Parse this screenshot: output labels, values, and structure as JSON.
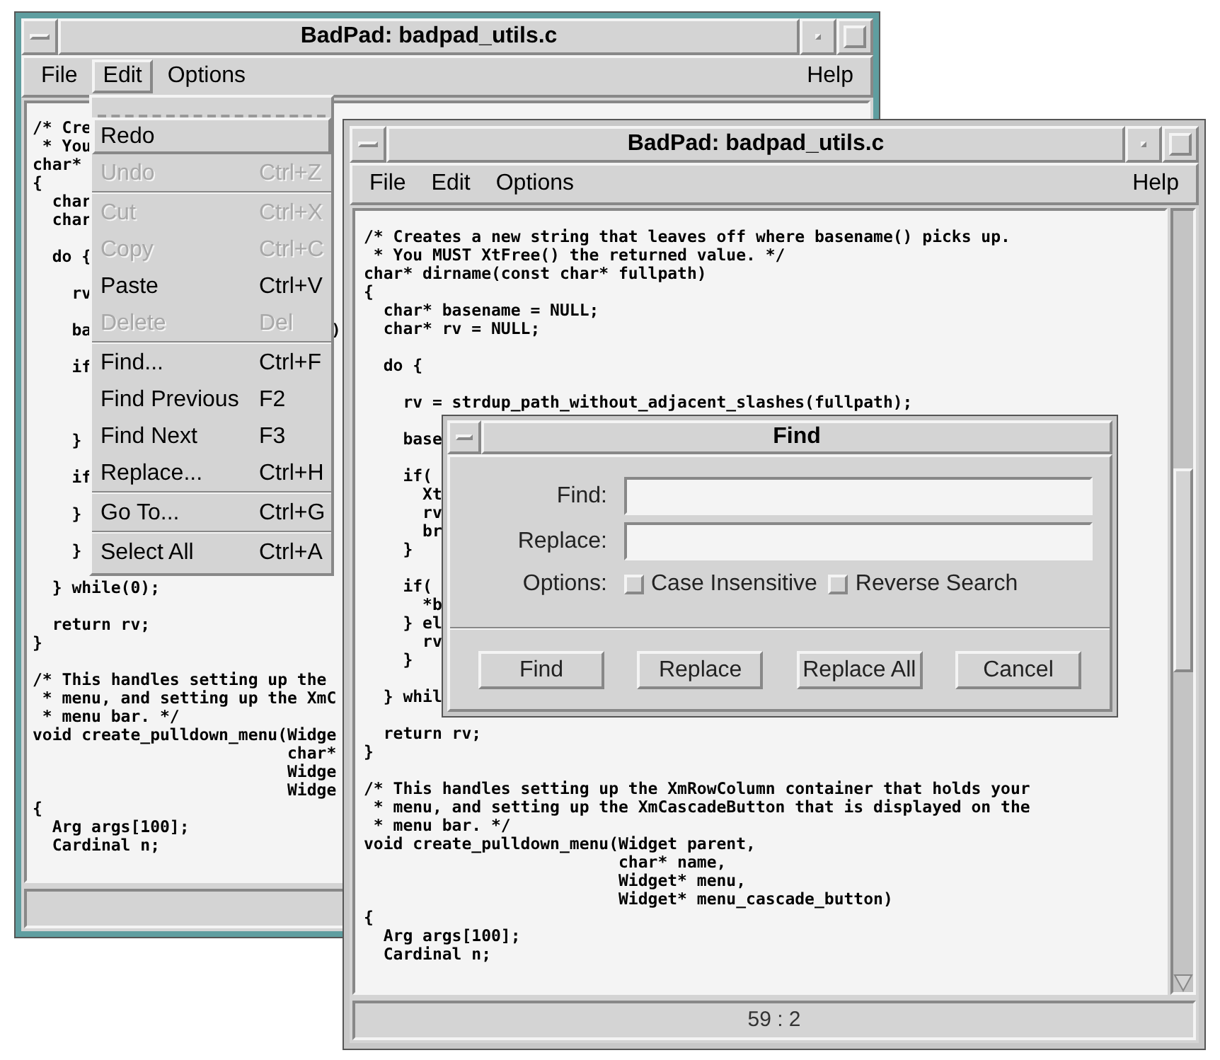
{
  "back_window": {
    "title": "BadPad: badpad_utils.c",
    "active": true,
    "menus": [
      {
        "label": "File",
        "selected": false
      },
      {
        "label": "Edit",
        "selected": true
      },
      {
        "label": "Options",
        "selected": false
      },
      {
        "label": "Help",
        "selected": false
      }
    ],
    "lines": [
      {
        "kind": "code",
        "text": "/* Cre"
      },
      {
        "kind": "code",
        "text": " * You"
      },
      {
        "kind": "code",
        "text": "char*"
      },
      {
        "kind": "code",
        "text": "{"
      },
      {
        "kind": "code",
        "text": "  char"
      },
      {
        "kind": "code",
        "text": "  char"
      },
      {
        "kind": "blank"
      },
      {
        "kind": "code",
        "text": "  do {"
      },
      {
        "kind": "blank"
      },
      {
        "kind": "code",
        "text": "    rv"
      },
      {
        "kind": "blank"
      },
      {
        "kind": "code",
        "text": "    ba",
        "right": ")"
      },
      {
        "kind": "blank"
      },
      {
        "kind": "code",
        "text": "    if"
      },
      {
        "kind": "blank"
      },
      {
        "kind": "blank"
      },
      {
        "kind": "blank"
      },
      {
        "kind": "code",
        "text": "    }"
      },
      {
        "kind": "blank"
      },
      {
        "kind": "code",
        "text": "    if"
      },
      {
        "kind": "blank"
      },
      {
        "kind": "code",
        "text": "    }"
      },
      {
        "kind": "blank"
      },
      {
        "kind": "code",
        "text": "    }"
      },
      {
        "kind": "blank"
      },
      {
        "kind": "code",
        "text": "  } while(0);"
      },
      {
        "kind": "blank"
      },
      {
        "kind": "code",
        "text": "  return rv;"
      },
      {
        "kind": "code",
        "text": "}"
      },
      {
        "kind": "blank"
      },
      {
        "kind": "code",
        "text": "/* This handles setting up the"
      },
      {
        "kind": "code",
        "text": " * menu, and setting up the XmC"
      },
      {
        "kind": "code",
        "text": " * menu bar. */"
      },
      {
        "kind": "code",
        "text": "void create_pulldown_menu(Widge"
      },
      {
        "kind": "code",
        "text": "                          char*"
      },
      {
        "kind": "code",
        "text": "                          Widge"
      },
      {
        "kind": "code",
        "text": "                          Widge"
      },
      {
        "kind": "code",
        "text": "{"
      },
      {
        "kind": "code",
        "text": "  Arg args[100];"
      },
      {
        "kind": "code",
        "text": "  Cardinal n;"
      }
    ]
  },
  "edit_menu": [
    {
      "kind": "tearoff"
    },
    {
      "kind": "item",
      "label": "Redo",
      "selected": true,
      "disabled": false
    },
    {
      "kind": "item",
      "label": "Undo",
      "shortcut": "Ctrl+Z",
      "selected": false,
      "disabled": true
    },
    {
      "kind": "separator"
    },
    {
      "kind": "item",
      "label": "Cut",
      "shortcut": "Ctrl+X",
      "selected": false,
      "disabled": true
    },
    {
      "kind": "item",
      "label": "Copy",
      "shortcut": "Ctrl+C",
      "selected": false,
      "disabled": true
    },
    {
      "kind": "item",
      "label": "Paste",
      "shortcut": "Ctrl+V",
      "selected": false,
      "disabled": false
    },
    {
      "kind": "item",
      "label": "Delete",
      "shortcut": "Del",
      "selected": false,
      "disabled": true
    },
    {
      "kind": "separator"
    },
    {
      "kind": "item",
      "label": "Find...",
      "shortcut": "Ctrl+F",
      "selected": false,
      "disabled": false
    },
    {
      "kind": "item",
      "label": "Find Previous",
      "shortcut": "F2",
      "selected": false,
      "disabled": false
    },
    {
      "kind": "item",
      "label": "Find Next",
      "shortcut": "F3",
      "selected": false,
      "disabled": false
    },
    {
      "kind": "item",
      "label": "Replace...",
      "shortcut": "Ctrl+H",
      "selected": false,
      "disabled": false
    },
    {
      "kind": "separator"
    },
    {
      "kind": "item",
      "label": "Go To...",
      "shortcut": "Ctrl+G",
      "selected": false,
      "disabled": false
    },
    {
      "kind": "separator"
    },
    {
      "kind": "item",
      "label": "Select All",
      "shortcut": "Ctrl+A",
      "selected": false,
      "disabled": false
    }
  ],
  "front_window": {
    "title": "BadPad: badpad_utils.c",
    "active": false,
    "menus": [
      {
        "label": "File",
        "selected": false
      },
      {
        "label": "Edit",
        "selected": false
      },
      {
        "label": "Options",
        "selected": false
      },
      {
        "label": "Help",
        "selected": false
      }
    ],
    "lines": [
      {
        "kind": "code",
        "text": "/* Creates a new string that leaves off where basename() picks up."
      },
      {
        "kind": "code",
        "text": " * You MUST XtFree() the returned value. */"
      },
      {
        "kind": "code",
        "text": "char* dirname(const char* fullpath)"
      },
      {
        "kind": "code",
        "text": "{"
      },
      {
        "kind": "code",
        "text": "  char* basename = NULL;"
      },
      {
        "kind": "code",
        "text": "  char* rv = NULL;"
      },
      {
        "kind": "blank"
      },
      {
        "kind": "code",
        "text": "  do {"
      },
      {
        "kind": "blank"
      },
      {
        "kind": "code",
        "text": "    rv = strdup_path_without_adjacent_slashes(fullpath);"
      },
      {
        "kind": "blank"
      },
      {
        "kind": "code",
        "text": "    base"
      },
      {
        "kind": "blank"
      },
      {
        "kind": "code",
        "text": "    if("
      },
      {
        "kind": "code",
        "text": "      Xt"
      },
      {
        "kind": "code",
        "text": "      rv"
      },
      {
        "kind": "code",
        "text": "      br"
      },
      {
        "kind": "code",
        "text": "    }"
      },
      {
        "kind": "blank"
      },
      {
        "kind": "code",
        "text": "    if("
      },
      {
        "kind": "code",
        "text": "      *b"
      },
      {
        "kind": "code",
        "text": "    } el"
      },
      {
        "kind": "code",
        "text": "      rv"
      },
      {
        "kind": "code",
        "text": "    }"
      },
      {
        "kind": "blank"
      },
      {
        "kind": "code",
        "text": "  } whil"
      },
      {
        "kind": "blank"
      },
      {
        "kind": "code",
        "text": "  return rv;"
      },
      {
        "kind": "code",
        "text": "}"
      },
      {
        "kind": "blank"
      },
      {
        "kind": "code",
        "text": "/* This handles setting up the XmRowColumn container that holds your"
      },
      {
        "kind": "code",
        "text": " * menu, and setting up the XmCascadeButton that is displayed on the"
      },
      {
        "kind": "code",
        "text": " * menu bar. */"
      },
      {
        "kind": "code",
        "text": "void create_pulldown_menu(Widget parent,"
      },
      {
        "kind": "code",
        "text": "                          char* name,"
      },
      {
        "kind": "code",
        "text": "                          Widget* menu,"
      },
      {
        "kind": "code",
        "text": "                          Widget* menu_cascade_button)"
      },
      {
        "kind": "code",
        "text": "{"
      },
      {
        "kind": "code",
        "text": "  Arg args[100];"
      },
      {
        "kind": "code",
        "text": "  Cardinal n;"
      }
    ],
    "status": "59 : 2"
  },
  "find_dialog": {
    "title": "Find",
    "fields": [
      {
        "label": "Find:"
      },
      {
        "label": "Replace:"
      }
    ],
    "options_label": "Options:",
    "options": [
      {
        "label": "Case Insensitive",
        "checked": false
      },
      {
        "label": "Reverse Search",
        "checked": false
      }
    ],
    "buttons": [
      "Find",
      "Replace",
      "Replace All",
      "Cancel"
    ]
  }
}
